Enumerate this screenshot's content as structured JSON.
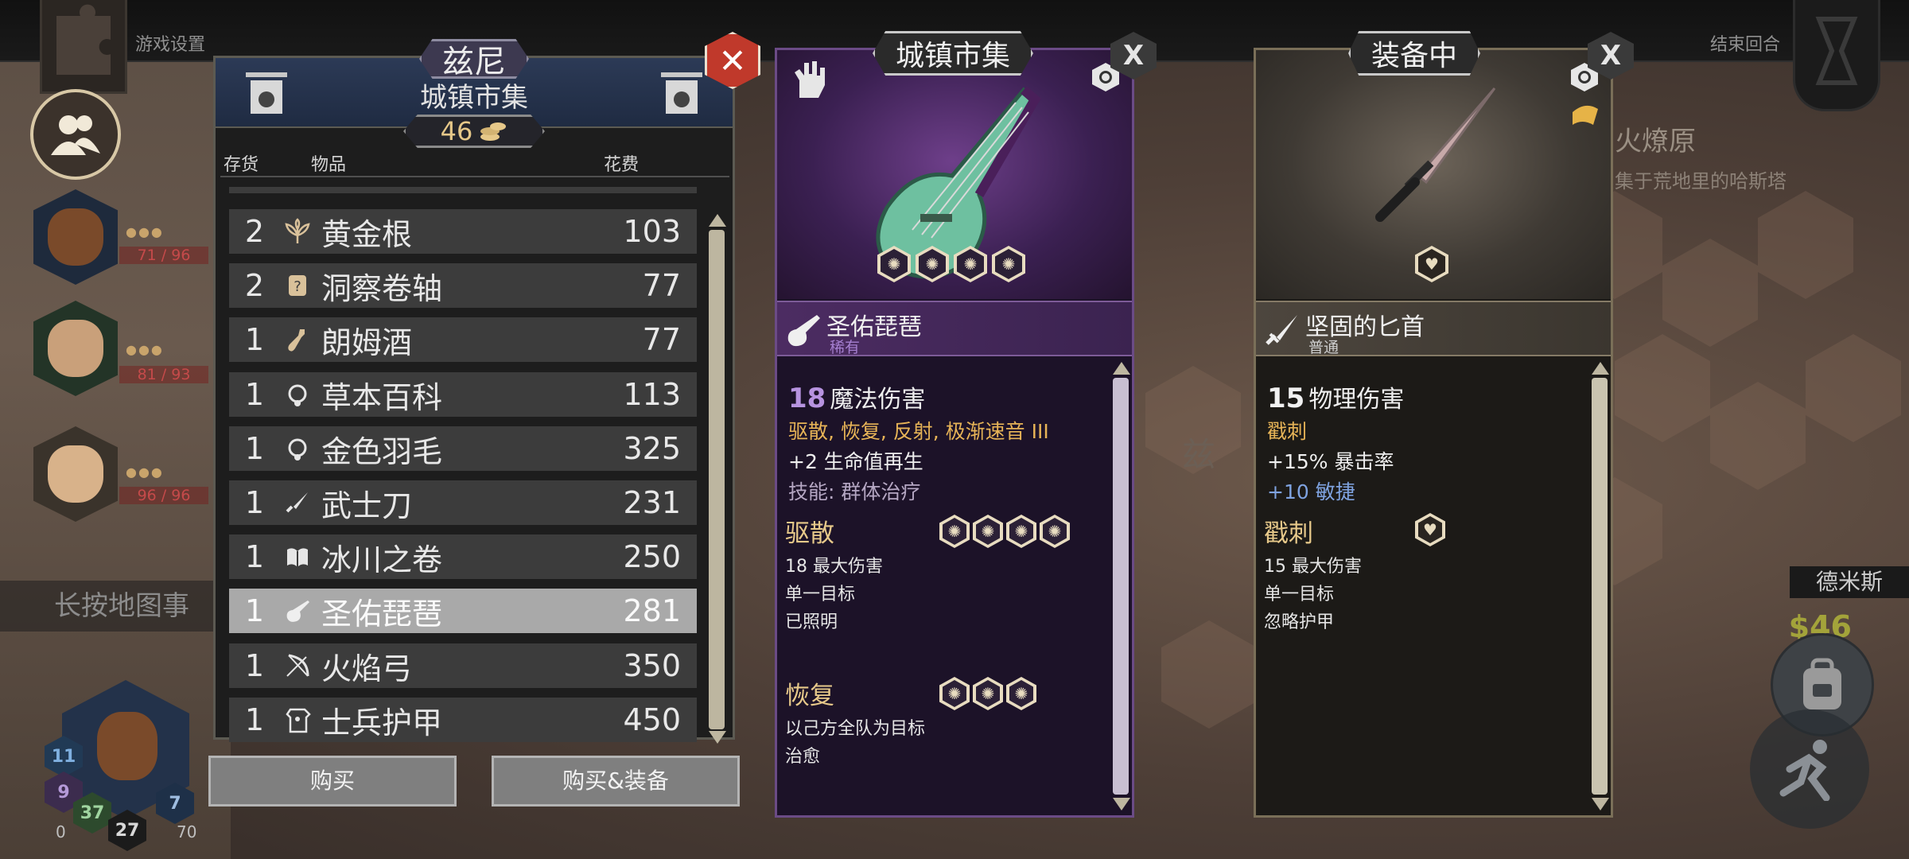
{
  "topbar": {
    "settings_label": "游戏设置",
    "end_turn_label": "结束回合"
  },
  "party": [
    {
      "hp": "71 / 96",
      "dots": "●●●"
    },
    {
      "hp": "81 / 93",
      "dots": "●●●"
    },
    {
      "hp": "96 / 96",
      "dots": "●●●"
    }
  ],
  "map_hint": "长按地图事",
  "bottom_hero": {
    "stat_shield": "11",
    "stat_block": "9",
    "stat_level": "37",
    "stat_move": "7",
    "stat_hp": "27",
    "stat_extra": "70",
    "stat_zero": "0"
  },
  "map": {
    "place_name": "火燎原",
    "place_desc": "集于荒地里的哈斯塔",
    "town_label": "兹",
    "right_name": "德米斯",
    "gold_float": "$46"
  },
  "shop": {
    "merchant_name": "兹尼",
    "subtitle": "城镇市集",
    "gold": "46",
    "col_stock": "存货",
    "col_item": "物品",
    "col_cost": "花费",
    "rows": [
      {
        "qty": "2",
        "icon": "herb-icon",
        "name": "黄金根",
        "price": "103"
      },
      {
        "qty": "2",
        "icon": "scroll-icon",
        "name": "洞察卷轴",
        "price": "77"
      },
      {
        "qty": "1",
        "icon": "bottle-icon",
        "name": "朗姆酒",
        "price": "77"
      },
      {
        "qty": "1",
        "icon": "necklace-icon",
        "name": "草本百科",
        "price": "113"
      },
      {
        "qty": "1",
        "icon": "necklace-icon",
        "name": "金色羽毛",
        "price": "325"
      },
      {
        "qty": "1",
        "icon": "sword-icon",
        "name": "武士刀",
        "price": "231"
      },
      {
        "qty": "1",
        "icon": "book-icon",
        "name": "冰川之卷",
        "price": "250"
      },
      {
        "qty": "1",
        "icon": "lute-icon",
        "name": "圣佑琵琶",
        "price": "281"
      },
      {
        "qty": "1",
        "icon": "bow-icon",
        "name": "火焰弓",
        "price": "350"
      },
      {
        "qty": "1",
        "icon": "armor-icon",
        "name": "士兵护甲",
        "price": "450"
      }
    ],
    "selected_index": 7,
    "buy_label": "购买",
    "buy_equip_label": "购买&装备"
  },
  "market_card": {
    "tab_label": "城镇市集",
    "close_label": "X",
    "item_name": "圣佑琵琶",
    "rarity": "稀有",
    "damage_value": "18",
    "damage_type": "魔法伤害",
    "traits": "驱散, 恢复, 反射, 极渐速音 III",
    "regen": "+2 生命值再生",
    "skill_line": "技能: 群体治疗",
    "skills": [
      {
        "name": "驱散",
        "desc": [
          "18 最大伤害",
          "单一目标",
          "已照明"
        ],
        "cost": 4
      },
      {
        "name": "恢复",
        "desc": [
          "以己方全队为目标",
          "治愈"
        ],
        "cost": 3
      }
    ],
    "accent_color": "#a57fd0"
  },
  "equip_card": {
    "tab_label": "装备中",
    "close_label": "X",
    "item_name": "坚固的匕首",
    "rarity": "普通",
    "damage_value": "15",
    "damage_type": "物理伤害",
    "traits": "戳刺",
    "crit": "+15% 暴击率",
    "agility": "+10 敏捷",
    "skills": [
      {
        "name": "戳刺",
        "desc": [
          "15 最大伤害",
          "单一目标",
          "忽略护甲"
        ]
      }
    ],
    "accent_color": "#7fa3e0"
  }
}
